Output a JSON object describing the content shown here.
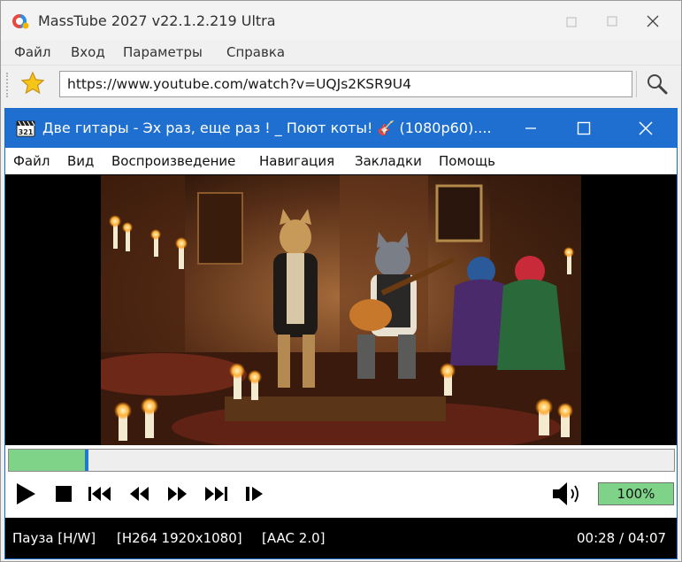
{
  "app": {
    "title": "MassTube 2027 v22.1.2.219 Ultra",
    "menu": [
      "Файл",
      "Вход",
      "Параметры",
      "Справка"
    ],
    "url": "https://www.youtube.com/watch?v=UQJs2KSR9U4"
  },
  "player": {
    "title": "Две гитары - Эх раз, еще раз ! _ Поют коты! 🎸 (1080p60)....",
    "menu": [
      "Файл",
      "Вид",
      "Воспроизведение",
      "Навигация",
      "Закладки",
      "Помощь"
    ],
    "progress": 0.115,
    "volume": "100%",
    "status": {
      "state": "Пауза [H/W]",
      "video": "[H264 1920x1080]",
      "audio": "[AAC 2.0]",
      "time": "00:28 / 04:07"
    }
  },
  "icons": [
    "app-logo-icon",
    "minimize-icon",
    "maximize-icon",
    "close-icon",
    "favorite-star-icon",
    "search-icon",
    "player-logo-icon",
    "play-icon",
    "stop-icon",
    "skip-previous-icon",
    "rewind-icon",
    "fast-forward-icon",
    "skip-next-icon",
    "frame-step-icon",
    "volume-icon"
  ],
  "colors": {
    "player_titlebar": "#1e6fd0",
    "progress_fill": "#7fd389",
    "volume_fill": "#7fd389",
    "seek_thumb": "#1f78d1"
  }
}
